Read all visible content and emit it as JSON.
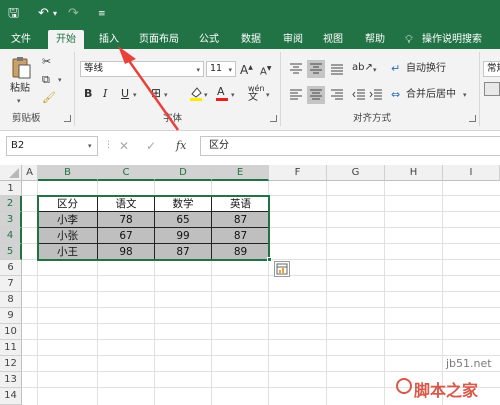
{
  "qat": {
    "save_icon": "floppy-icon",
    "undo_icon": "undo-icon",
    "redo_icon": "redo-icon",
    "customize_icon": "customize-icon"
  },
  "tabs": [
    "文件",
    "开始",
    "插入",
    "页面布局",
    "公式",
    "数据",
    "审阅",
    "视图",
    "帮助"
  ],
  "tell_me": "操作说明搜索",
  "clipboard": {
    "paste_label": "粘贴",
    "group_label": "剪贴板"
  },
  "font": {
    "name": "等线",
    "size": "11",
    "bold": "B",
    "italic": "I",
    "underline": "U",
    "font_color_letter": "A",
    "phonetic": "wén",
    "group_label": "字体"
  },
  "alignment": {
    "wrap_text": "自动换行",
    "merge_center": "合并后居中",
    "group_label": "对齐方式"
  },
  "number": {
    "format": "常规"
  },
  "formula_bar": {
    "name_box": "B2",
    "fx": "fx",
    "value": "区分"
  },
  "columns": [
    "A",
    "B",
    "C",
    "D",
    "E",
    "F",
    "G",
    "H",
    "I"
  ],
  "rows": [
    "1",
    "2",
    "3",
    "4",
    "5",
    "6",
    "7",
    "8",
    "9",
    "10",
    "11",
    "12",
    "13",
    "14"
  ],
  "table": {
    "header": [
      "区分",
      "语文",
      "数学",
      "英语"
    ],
    "rows": [
      [
        "小李",
        "78",
        "65",
        "87"
      ],
      [
        "小张",
        "67",
        "99",
        "87"
      ],
      [
        "小王",
        "98",
        "87",
        "89"
      ]
    ]
  },
  "colors": {
    "excel_green": "#217346",
    "arrow_red": "#e8413a",
    "table_fill": "#bfbfbf"
  },
  "watermark": {
    "site": "jb51.net",
    "name": "脚本之家"
  }
}
